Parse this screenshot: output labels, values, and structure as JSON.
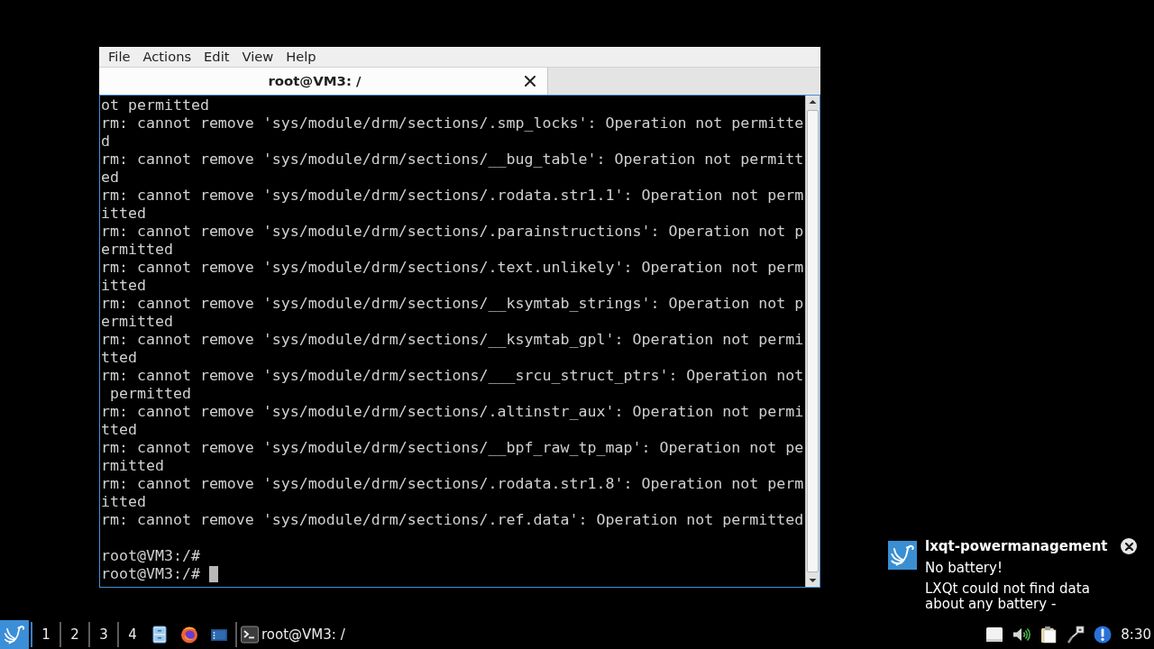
{
  "window": {
    "menu": [
      "File",
      "Actions",
      "Edit",
      "View",
      "Help"
    ],
    "tabs": [
      {
        "title": "root@VM3: /",
        "selected": true
      }
    ]
  },
  "terminal": {
    "lines": [
      "ot permitted",
      "rm: cannot remove 'sys/module/drm/sections/.smp_locks': Operation not permitte",
      "d",
      "rm: cannot remove 'sys/module/drm/sections/__bug_table': Operation not permitt",
      "ed",
      "rm: cannot remove 'sys/module/drm/sections/.rodata.str1.1': Operation not perm",
      "itted",
      "rm: cannot remove 'sys/module/drm/sections/.parainstructions': Operation not p",
      "ermitted",
      "rm: cannot remove 'sys/module/drm/sections/.text.unlikely': Operation not perm",
      "itted",
      "rm: cannot remove 'sys/module/drm/sections/__ksymtab_strings': Operation not p",
      "ermitted",
      "rm: cannot remove 'sys/module/drm/sections/__ksymtab_gpl': Operation not permi",
      "tted",
      "rm: cannot remove 'sys/module/drm/sections/___srcu_struct_ptrs': Operation not",
      " permitted",
      "rm: cannot remove 'sys/module/drm/sections/.altinstr_aux': Operation not permi",
      "tted",
      "rm: cannot remove 'sys/module/drm/sections/__bpf_raw_tp_map': Operation not pe",
      "rmitted",
      "rm: cannot remove 'sys/module/drm/sections/.rodata.str1.8': Operation not perm",
      "itted",
      "rm: cannot remove 'sys/module/drm/sections/.ref.data': Operation not permitted"
    ],
    "prompts": [
      {
        "text": "root@VM3:/#",
        "cursor": false
      },
      {
        "text": "root@VM3:/#",
        "cursor": true
      }
    ]
  },
  "notification": {
    "title": "lxqt-powermanagement",
    "summary": "No battery!",
    "body": "LXQt could not find data about any battery -"
  },
  "taskbar": {
    "desktops": [
      {
        "label": "1",
        "selected": false
      },
      {
        "label": "2",
        "selected": false
      },
      {
        "label": "3",
        "selected": false
      },
      {
        "label": "4",
        "selected": false
      }
    ],
    "tasks": [
      {
        "label": "root@VM3: /"
      }
    ],
    "clock": "8:30"
  }
}
